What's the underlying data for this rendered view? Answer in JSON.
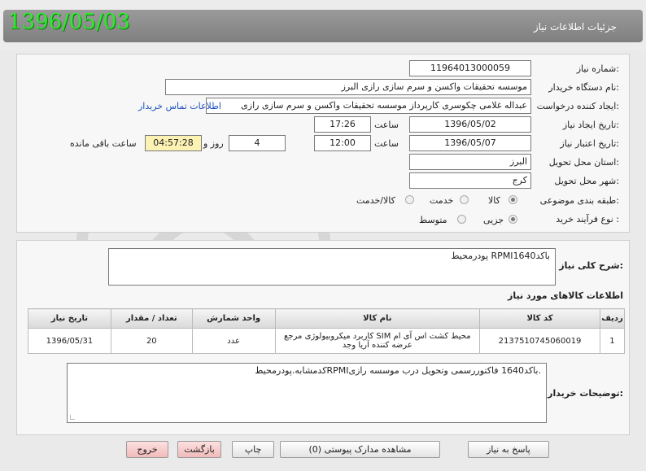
{
  "header": {
    "title": "جزئیات اطلاعات نیاز",
    "date_stamp": "1396/05/03"
  },
  "form": {
    "need_number_label": "شماره نیاز:",
    "need_number": "1196401300005‌9",
    "buyer_org_label": "نام دستگاه خریدار:",
    "buyer_org": "موسسه تحقیقات واکسن و سرم سازی رازی البرز",
    "requester_label": "ایجاد کننده درخواست:",
    "requester": "عبداله غلامی چکوسری کارپرداز موسسه تحقیقات واکسن و سرم سازی رازی",
    "contact_link": "اطلاعات تماس خریدار",
    "create_date_label": "تاریخ ایجاد نیاز:",
    "create_date": "1396/05/02",
    "create_time_label": "ساعت",
    "create_time": "17:26",
    "valid_date_label": "تاریخ اعتبار نیاز:",
    "valid_date": "1396/05/07",
    "valid_time_label": "ساعت",
    "valid_time": "12:00",
    "days": "4",
    "days_label": "روز و",
    "remaining_time": "04:57:28",
    "remaining_label": "ساعت باقی مانده",
    "province_label": "استان محل تحویل:",
    "province": "البرز",
    "city_label": "شهر محل تحویل:",
    "city": "کرج",
    "category_label": "طبقه بندی موضوعی:",
    "category_options": [
      "کالا",
      "خدمت",
      "کالا/خدمت"
    ],
    "process_label": "نوع فرآیند خرید :",
    "process_options": [
      "جزیی",
      "متوسط"
    ]
  },
  "summary": {
    "label": "شرح کلی نیاز:",
    "text": "پودرمحیط RPMIباکد1640"
  },
  "items_section": {
    "title": "اطلاعات کالاهای مورد نیاز",
    "columns": [
      "ردیف",
      "کد کالا",
      "نام کالا",
      "واحد شمارش",
      "تعداد / مقدار",
      "تاریخ نیاز"
    ],
    "rows": [
      [
        "1",
        "2137510745060019",
        "محیط کشت اس آی ام SIM کاربرد میکروبیولوژی مرجع عرضه کننده آریا وجد",
        "عدد",
        "20",
        "1396/05/31"
      ]
    ]
  },
  "buyer_notes": {
    "label": "توضیحات خریدار:",
    "text": "کدمشابه.پودرمحیطRPMIباکد1640 فاکتوررسمی وتحویل درب موسسه رازی."
  },
  "buttons": {
    "reply": "پاسخ به نیاز",
    "attachments": "مشاهده مدارک پیوستی (0)",
    "print": "چاپ",
    "back": "بازگشت",
    "exit": "خروج"
  }
}
